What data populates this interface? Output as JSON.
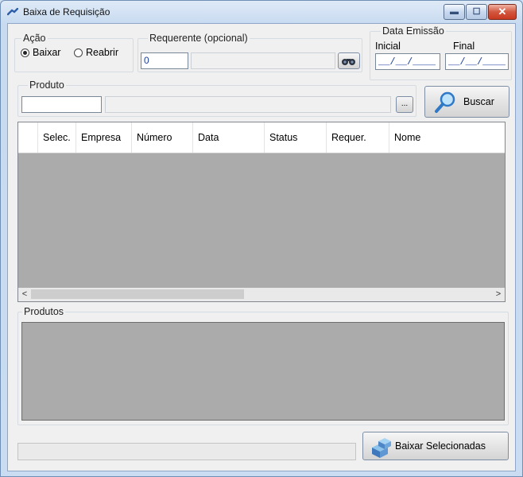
{
  "window": {
    "title": "Baixa de Requisição"
  },
  "acao": {
    "legend": "Ação",
    "options": [
      {
        "label": "Baixar",
        "checked": true
      },
      {
        "label": "Reabrir",
        "checked": false
      }
    ]
  },
  "requerente": {
    "legend": "Requerente (opcional)",
    "code": "0",
    "name": ""
  },
  "data_emissao": {
    "legend": "Data Emissão",
    "inicial_label": "Inicial",
    "final_label": "Final",
    "inicial_value": "__/__/____",
    "final_value": "__/__/____"
  },
  "produto": {
    "legend": "Produto",
    "code": "",
    "name": "",
    "browse_label": "..."
  },
  "buscar": {
    "label": "Buscar"
  },
  "grid": {
    "columns": [
      "Selec.",
      "Empresa",
      "Número",
      "Data",
      "Status",
      "Requer.",
      "Nome"
    ]
  },
  "produtos": {
    "legend": "Produtos"
  },
  "baixar_selecionadas": {
    "label": "Baixar Selecionadas"
  },
  "status_text": "",
  "colors": {
    "grid_background": "#ababab",
    "accent": "#1c3f9e"
  }
}
